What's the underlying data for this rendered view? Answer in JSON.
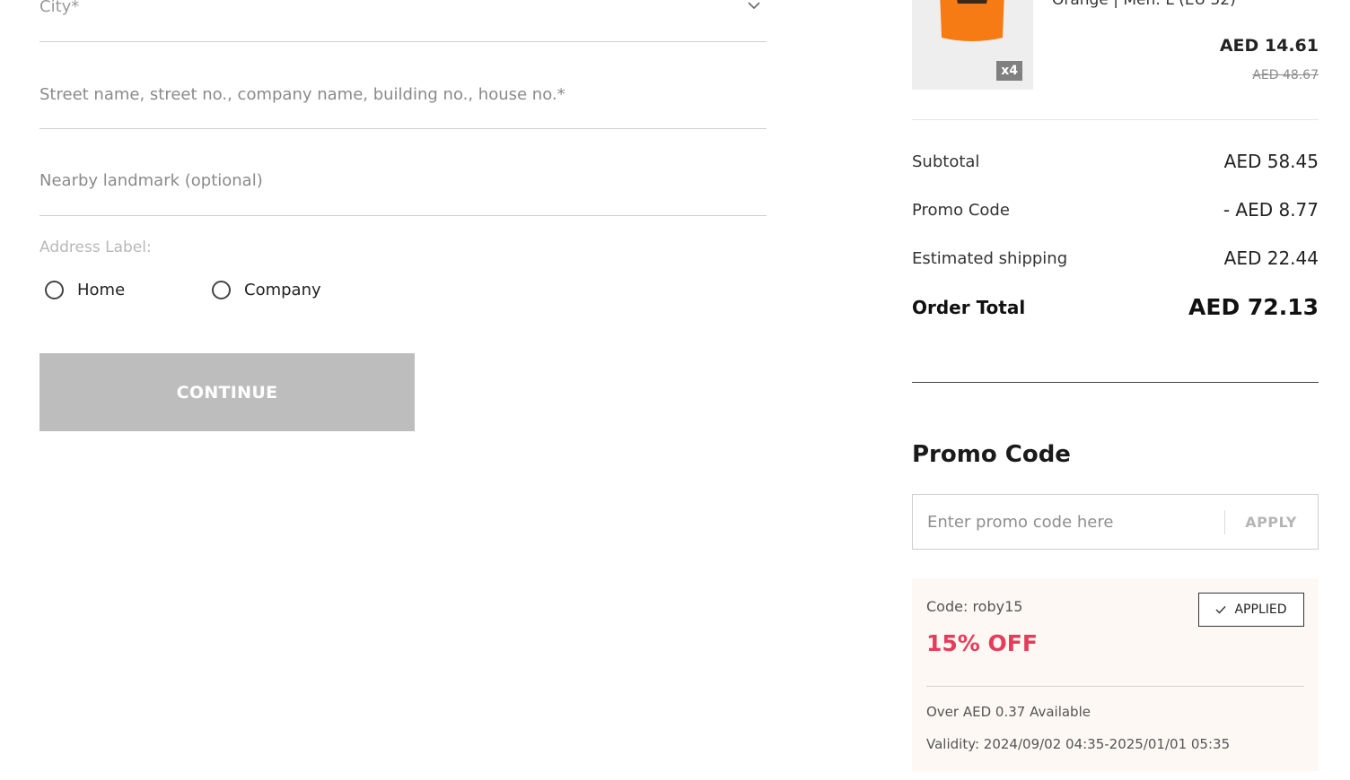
{
  "address_form": {
    "city_placeholder": "City*",
    "street_placeholder": "Street name, street no., company name, building no., house no.*",
    "landmark_placeholder": "Nearby landmark (optional)",
    "address_label_title": "Address Label:",
    "label_options": [
      "Home",
      "Company"
    ],
    "continue_label": "CONTINUE"
  },
  "cart_item": {
    "variant": "Orange | Men: L (EU 52)",
    "quantity_badge": "x4",
    "sale_price": "AED 14.61",
    "original_price": "AED 48.67",
    "colors": {
      "shirt": "#f77b14",
      "print": "#1a1a1a"
    }
  },
  "summary": {
    "subtotal_label": "Subtotal",
    "subtotal_value": "AED 58.45",
    "promo_label": "Promo Code",
    "promo_value": "- AED 8.77",
    "shipping_label": "Estimated shipping",
    "shipping_value": "AED 22.44",
    "total_label": "Order Total",
    "total_value": "AED 72.13"
  },
  "promo": {
    "heading": "Promo Code",
    "input_placeholder": "Enter promo code here",
    "apply_label": "APPLY",
    "coupon": {
      "code_text": "Code: roby15",
      "status": "APPLIED",
      "discount_text": "15% OFF",
      "min_spend_text": "Over AED 0.37 Available",
      "validity_text": "Validity: 2024/09/02 04:35-2025/01/01 05:35"
    }
  },
  "colors": {
    "discount_accent": "#e63c5c",
    "disabled_button": "#bdbdbd",
    "coupon_background": "#fdf8f3"
  },
  "icons": {
    "city_dropdown": "chevron-down-icon",
    "applied": "check-icon"
  }
}
